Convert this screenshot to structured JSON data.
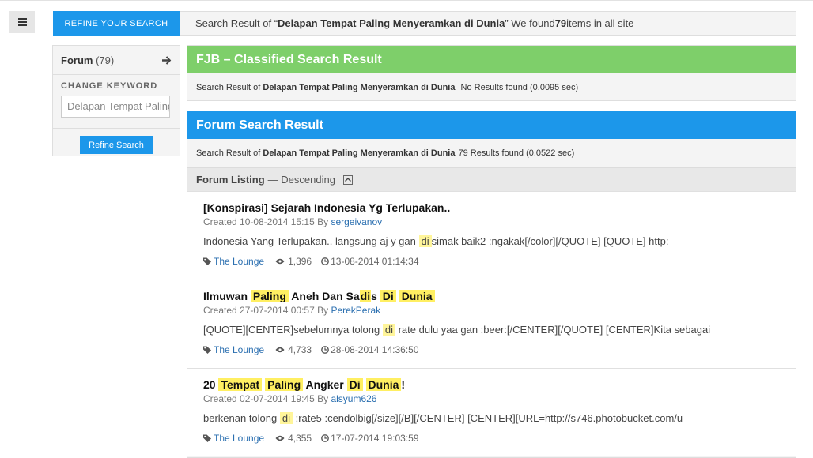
{
  "menu": {
    "icon": "hamburger-icon"
  },
  "refine_tab": {
    "label": "REFINE YOUR SEARCH"
  },
  "result_bar": {
    "prefix": "Search Result of “",
    "query": "Delapan Tempat Paling Menyeramkan di Dunia",
    "mid": "” We found ",
    "count": "79",
    "suffix": " items in all site"
  },
  "sidebar": {
    "forum_label": "Forum",
    "forum_count": "(79)",
    "change_keyword_label": "CHANGE KEYWORD",
    "keyword_value": "Delapan Tempat Paling Menyeramkan di Dunia",
    "refine_button": "Refine Search"
  },
  "fjb": {
    "title": "FJB – Classified Search Result",
    "sub_prefix": "Search Result of",
    "sub_query": "Delapan Tempat Paling Menyeramkan di Dunia",
    "sub_result": "No Results found (0.0095 sec)"
  },
  "forum": {
    "title": "Forum Search Result",
    "sub_prefix": "Search Result of",
    "sub_query": "Delapan Tempat Paling Menyeramkan di Dunia",
    "sub_result": "79 Results found (0.0522 sec)",
    "listing_label": "Forum Listing",
    "listing_order": "— Descending"
  },
  "items": [
    {
      "title": "[Konspirasi] Sejarah Indonesia Yg Terlupakan..",
      "created_prefix": "Created 10-08-2014 15:15 By ",
      "author": "sergeivanov",
      "snippet_a": "Indonesia Yang Terlupakan.. langsung aj y gan ",
      "snippet_hl": "di",
      "snippet_b": "simak baik2 :ngakak[/color][/QUOTE] [QUOTE] http:",
      "category": "The Lounge",
      "views": "1,396",
      "date": "13-08-2014 01:14:34"
    },
    {
      "title_parts": [
        "Ilmuwan ",
        "Paling",
        " Aneh Dan Sa",
        "di",
        "s ",
        "Di",
        " ",
        "Dunia"
      ],
      "created_prefix": "Created 27-07-2014 00:57 By ",
      "author": "PerekPerak",
      "snippet_a": "[QUOTE][CENTER]sebelumnya tolong ",
      "snippet_hl": "di",
      "snippet_b": " rate dulu yaa gan :beer:[/CENTER][/QUOTE] [CENTER]Kita sebagai",
      "category": "The Lounge",
      "views": "4,733",
      "date": "28-08-2014 14:36:50"
    },
    {
      "title_parts": [
        "20 ",
        "Tempat",
        " ",
        "Paling",
        " Angker ",
        "Di",
        " ",
        "Dunia",
        "!"
      ],
      "created_prefix": "Created 02-07-2014 19:45 By ",
      "author": "alsyum626",
      "snippet_a": "berkenan tolong ",
      "snippet_hl": "di",
      "snippet_b": " :rate5 :cendolbig[/size][/B][/CENTER] [CENTER][URL=http://s746.photobucket.com/u",
      "category": "The Lounge",
      "views": "4,355",
      "date": "17-07-2014 19:03:59"
    }
  ]
}
